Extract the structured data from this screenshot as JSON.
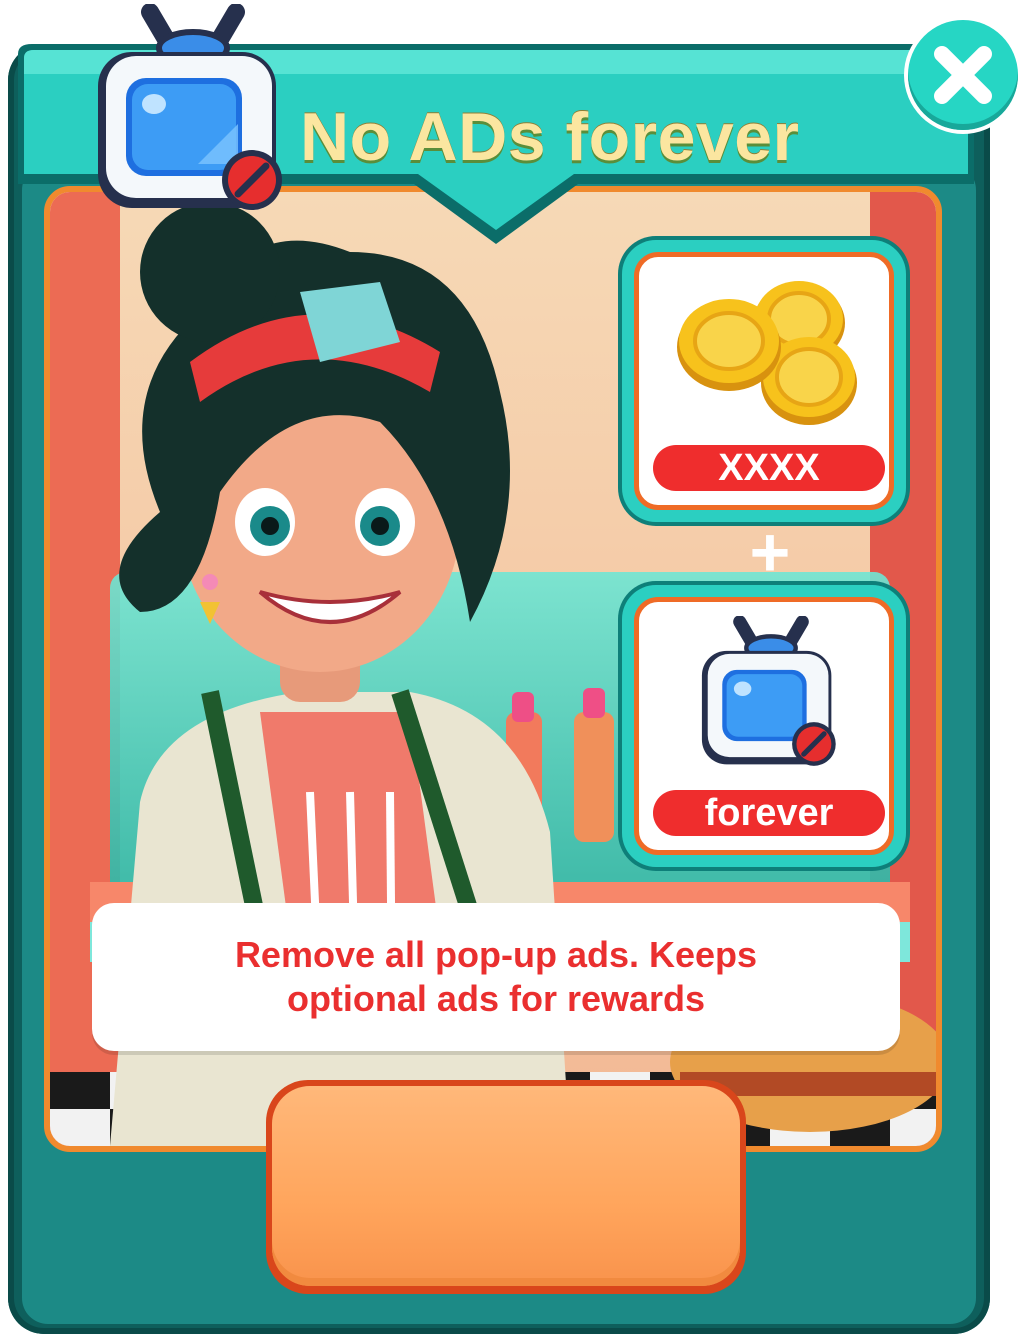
{
  "header": {
    "title": "No ADs forever",
    "icon": "no-ads-tv-icon"
  },
  "close_button": {
    "icon": "close-icon"
  },
  "rewards": [
    {
      "icon": "gold-coins-icon",
      "label": "XXXX"
    },
    {
      "icon": "no-ads-tv-icon",
      "label": "forever"
    }
  ],
  "plus_sign": "+",
  "description": "Remove all pop-up ads. Keeps optional ads for rewards",
  "colors": {
    "panel": "#0e5f5c",
    "ribbon": "#2bcfc1",
    "title": "#fbe6a0",
    "accent_red": "#ef2d2d",
    "card_border": "#ef6b26",
    "button": "#ffa55c"
  }
}
